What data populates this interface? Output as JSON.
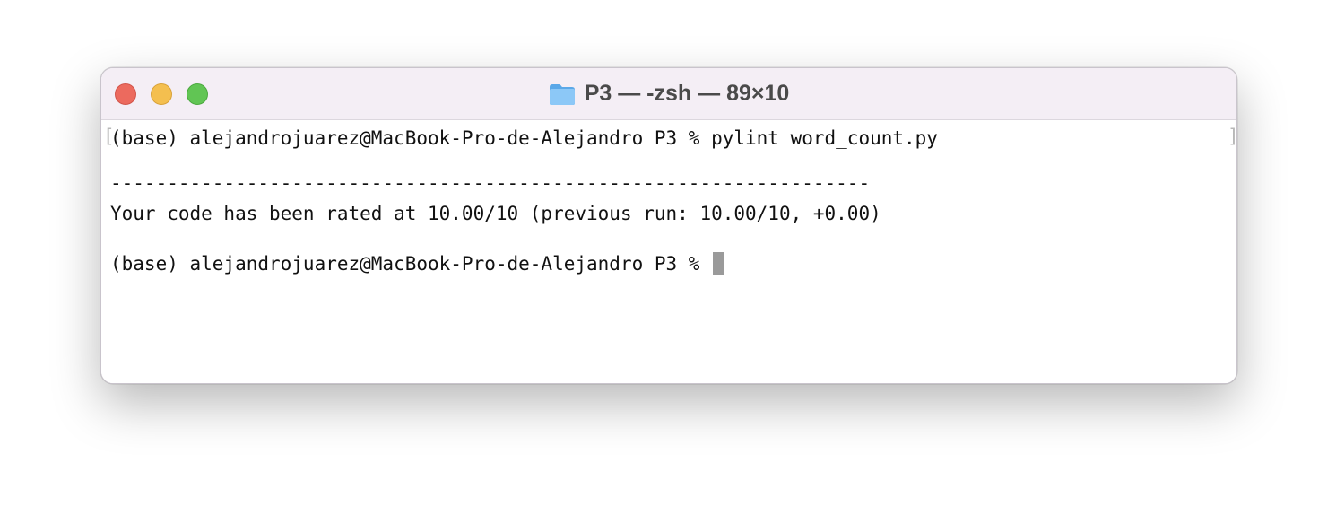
{
  "window": {
    "title": "P3 — -zsh — 89×10",
    "controls": {
      "close_color": "#ec6a5e",
      "minimize_color": "#f4bf4f",
      "zoom_color": "#61c554"
    },
    "title_icon": "folder-icon"
  },
  "terminal": {
    "lines": [
      "(base) alejandrojuarez@MacBook-Pro-de-Alejandro P3 % pylint word_count.py",
      "",
      "-------------------------------------------------------------------",
      "Your code has been rated at 10.00/10 (previous run: 10.00/10, +0.00)",
      "",
      "(base) alejandrojuarez@MacBook-Pro-de-Alejandro P3 % "
    ],
    "selection_left": "[",
    "selection_right": "]"
  }
}
